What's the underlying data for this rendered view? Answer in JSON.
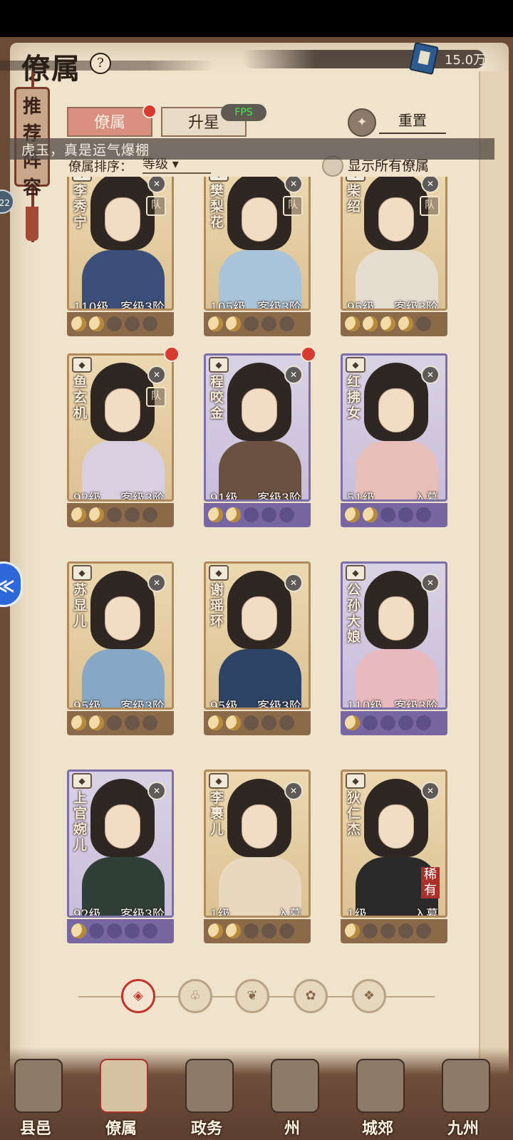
{
  "header": {
    "title": "僚属",
    "help": "?",
    "currency_value": "15.0万"
  },
  "recommend_tag": "推荐阵容",
  "side_badge": "22",
  "float_button": "≪",
  "fps_overlay": "FPS",
  "tabs": [
    {
      "label": "僚属",
      "active": true
    },
    {
      "label": "升星",
      "active": false
    }
  ],
  "reset_label": "重置",
  "marquee_text": "虎玉，真是运气爆棚",
  "sort": {
    "label": "僚属排序：",
    "value": "等级"
  },
  "show_all_label": "显示所有僚属",
  "cards": [
    {
      "name": "李秀宁",
      "level": "110级",
      "rank": "客级3阶",
      "stars": 2,
      "frame": "gold",
      "team": true
    },
    {
      "name": "樊梨花",
      "level": "105级",
      "rank": "客级3阶",
      "stars": 2,
      "frame": "gold",
      "team": true
    },
    {
      "name": "柴绍",
      "level": "95级",
      "rank": "客级3阶",
      "stars": 4,
      "frame": "gold",
      "team": true
    },
    {
      "name": "鱼玄机",
      "level": "92级",
      "rank": "客级3阶",
      "stars": 2,
      "frame": "gold",
      "team": true,
      "alert": true
    },
    {
      "name": "程咬金",
      "level": "91级",
      "rank": "客级3阶",
      "stars": 2,
      "frame": "blue",
      "alert": true
    },
    {
      "name": "红拂女",
      "level": "51级",
      "rank": "入幕",
      "stars": 2,
      "frame": "blue"
    },
    {
      "name": "苏显儿",
      "level": "95级",
      "rank": "客级3阶",
      "stars": 2,
      "frame": "gold"
    },
    {
      "name": "谢瑶环",
      "level": "95级",
      "rank": "客级3阶",
      "stars": 2,
      "frame": "gold"
    },
    {
      "name": "公孙大娘",
      "level": "110级",
      "rank": "客级3阶",
      "stars": 1,
      "frame": "blue"
    },
    {
      "name": "上官婉儿",
      "level": "92级",
      "rank": "客级3阶",
      "stars": 1,
      "frame": "blue"
    },
    {
      "name": "李裹儿",
      "level": "1级",
      "rank": "入幕",
      "stars": 2,
      "frame": "gold"
    },
    {
      "name": "狄仁杰",
      "level": "1级",
      "rank": "入幕",
      "stars": 1,
      "frame": "gold",
      "rare": "稀有"
    }
  ],
  "filters": [
    "all-icon",
    "bell-icon",
    "gourd-icon",
    "fan-icon",
    "lion-icon"
  ],
  "bottom_nav": [
    {
      "label": "县邑"
    },
    {
      "label": "僚属",
      "active": true
    },
    {
      "label": "政务"
    },
    {
      "label": "州"
    },
    {
      "label": "城郊"
    },
    {
      "label": "九州"
    }
  ],
  "colors": {
    "paper": "#efe3cc",
    "tab_active": "#d98f80",
    "frame_gold": "#b08a5a",
    "frame_blue": "#7a6fa8",
    "alert_red": "#d63a30"
  }
}
